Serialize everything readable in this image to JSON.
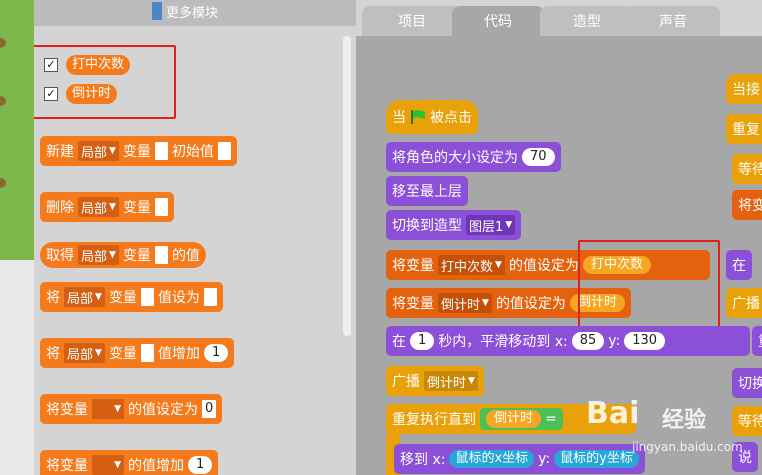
{
  "palette": {
    "more_modules": "更多模块",
    "variables": [
      {
        "label": "打中次数",
        "checked": true
      },
      {
        "label": "倒计时",
        "checked": true
      }
    ],
    "blocks": {
      "new_var": {
        "prefix": "新建",
        "scope": "局部",
        "mid": "变量",
        "init": "初始值"
      },
      "delete_var": {
        "prefix": "删除",
        "scope": "局部",
        "mid": "变量"
      },
      "get_var": {
        "prefix": "取得",
        "scope": "局部",
        "mid": "变量",
        "suffix": "的值"
      },
      "set_var": {
        "prefix": "将",
        "scope": "局部",
        "mid": "变量",
        "suffix": "值设为"
      },
      "inc_var": {
        "prefix": "将",
        "scope": "局部",
        "mid": "变量",
        "suffix": "值增加",
        "value": "1"
      },
      "set_var2": {
        "prefix": "将变量",
        "suffix": "的值设定为",
        "value": "0"
      },
      "inc_var2": {
        "prefix": "将变量",
        "suffix": "的值增加",
        "value": "1"
      }
    }
  },
  "tabs": [
    {
      "label": "项目",
      "active": false
    },
    {
      "label": "代码",
      "active": true
    },
    {
      "label": "造型",
      "active": false
    },
    {
      "label": "声音",
      "active": false
    }
  ],
  "script": {
    "when_flag": {
      "before": "当",
      "after": "被点击"
    },
    "set_size": {
      "label": "将角色的大小设定为",
      "value": "70"
    },
    "to_front": {
      "label": "移至最上层"
    },
    "switch_costume": {
      "label": "切换到造型",
      "value": "图层1"
    },
    "set_hits": {
      "prefix": "将变量",
      "var": "打中次数",
      "mid": "的值设定为",
      "value": "打中次数"
    },
    "set_timer": {
      "prefix": "将变量",
      "var": "倒计时",
      "mid": "的值设定为",
      "value": "倒计时"
    },
    "glide": {
      "prefix": "在",
      "secs": "1",
      "mid": "秒内，平滑移动到 x:",
      "x": "85",
      "ylabel": "y:",
      "y": "130"
    },
    "broadcast": {
      "label": "广播",
      "value": "倒计时"
    },
    "repeat_until": {
      "label": "重复执行直到",
      "cond": "倒计时",
      "op": "="
    },
    "move_to": {
      "label": "移到 x:",
      "x": "鼠标的x坐标",
      "ylabel": "y:",
      "y": "鼠标的y坐标"
    }
  },
  "right_stack": [
    {
      "label": "当接",
      "color": "#e9a10a"
    },
    {
      "label": "重复",
      "color": "#e9a10a"
    },
    {
      "label": "等待",
      "color": "#e9a10a"
    },
    {
      "label": "将变",
      "color": "#e4610e"
    },
    {
      "label": "在",
      "color": "#8c4fd8"
    },
    {
      "label": "广播",
      "color": "#e9a10a"
    },
    {
      "label": "重",
      "color": "#8c4fd8"
    },
    {
      "label": "切换",
      "color": "#8c4fd8"
    },
    {
      "label": "等待",
      "color": "#e9a10a"
    },
    {
      "label": "说",
      "color": "#8c4fd8"
    }
  ],
  "watermark": {
    "brand": "Bai",
    "paw": "经验",
    "url": "jingyan.baidu.com"
  },
  "colors": {
    "event": "#e9a10a",
    "looks": "#8c4fd8",
    "data": "#f47a1c",
    "sensing": "#27a7d8",
    "accent_box": "#e02020"
  }
}
